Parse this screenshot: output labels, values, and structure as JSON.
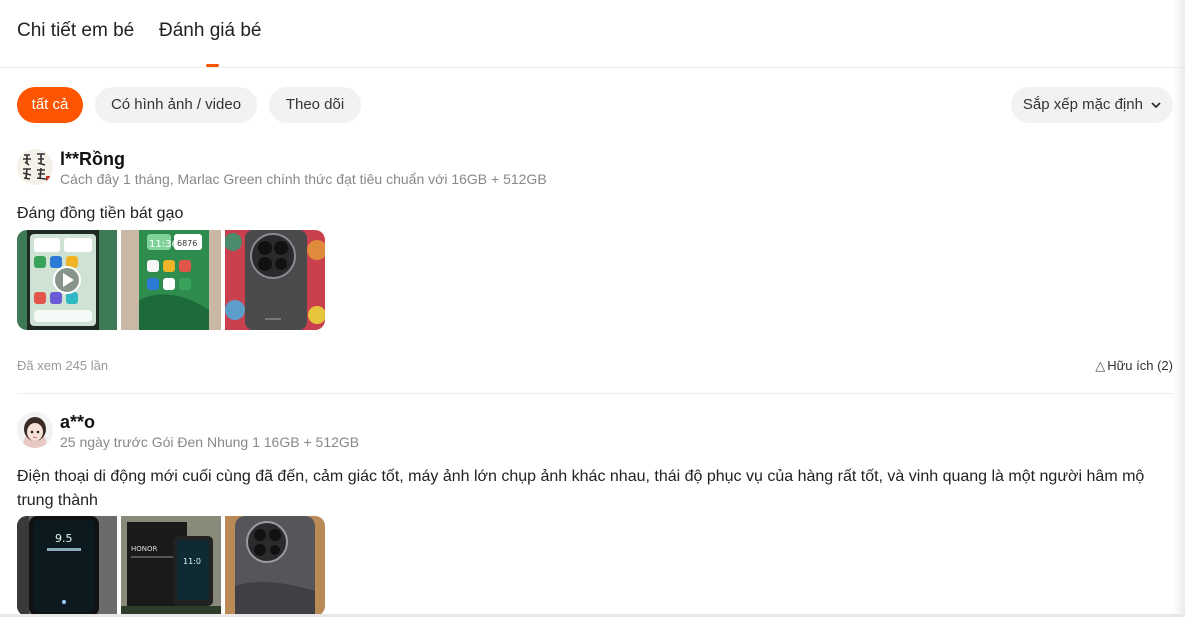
{
  "tabs": [
    {
      "label": "Chi tiết em bé"
    },
    {
      "label": "Đánh giá bé"
    }
  ],
  "filters": [
    {
      "label": "tất cả",
      "active": true
    },
    {
      "label": "Có hình ảnh / video",
      "active": false
    },
    {
      "label": "Theo dõi",
      "active": false
    }
  ],
  "sort": {
    "label": "Sắp xếp mặc định",
    "icon": "chevron-down-icon"
  },
  "colors": {
    "accent": "#ff5500"
  },
  "reviews": [
    {
      "user": "l**Rồng",
      "meta": "Cách đây 1 tháng, Marlac Green chính thức đạt tiêu chuẩn với 16GB + 512GB",
      "content": "Đáng đồng tiền bát gạo",
      "images": [
        "phone-screen-video-thumbnail",
        "phone-screen-photo",
        "phone-camera-back-photo"
      ],
      "views": "Đã xem 245 lần",
      "helpful": "Hữu ích (2)"
    },
    {
      "user": "a**o",
      "meta": "25 ngày trước Gói Đen Nhung 1 16GB + 512GB",
      "content": "Điện thoại di động mới cuối cùng đã đến, cảm giác tốt, máy ảnh lớn chụp ảnh khác nhau, thái độ phục vụ của hàng rất tốt, và vinh quang là một người hâm mộ trung thành",
      "images": [
        "phone-lockscreen-photo",
        "phone-box-photo",
        "phone-camera-back-photo"
      ]
    }
  ]
}
